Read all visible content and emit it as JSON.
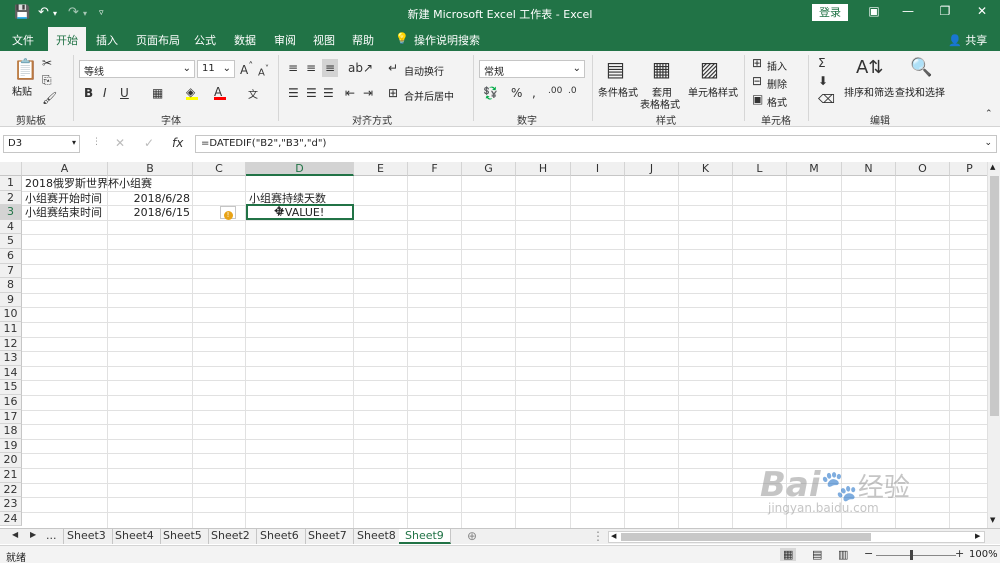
{
  "window": {
    "title": "新建 Microsoft Excel 工作表 - Excel",
    "login_label": "登录",
    "share_label": "共享"
  },
  "ribbon_tabs": [
    "文件",
    "开始",
    "插入",
    "页面布局",
    "公式",
    "数据",
    "审阅",
    "视图",
    "帮助",
    "操作说明搜索"
  ],
  "ribbon": {
    "clipboard": {
      "paste": "粘贴",
      "label": "剪贴板"
    },
    "font": {
      "name": "等线",
      "size": "11",
      "label": "字体"
    },
    "alignment": {
      "wrap": "自动换行",
      "merge": "合并后居中",
      "label": "对齐方式"
    },
    "number": {
      "format": "常规",
      "label": "数字"
    },
    "styles": {
      "conditional": "条件格式",
      "table_1": "套用",
      "table_2": "表格格式",
      "cell_styles": "单元格样式",
      "label": "样式"
    },
    "cells": {
      "insert": "插入",
      "delete": "删除",
      "format": "格式",
      "label": "单元格"
    },
    "editing": {
      "sort": "排序和筛选",
      "find": "查找和选择",
      "label": "编辑"
    }
  },
  "formula_bar": {
    "name_box": "D3",
    "formula": "=DATEDIF(\"B2\",\"B3\",\"d\")",
    "fx": "fx"
  },
  "columns": [
    "A",
    "B",
    "C",
    "D",
    "E",
    "F",
    "G",
    "H",
    "I",
    "J",
    "K",
    "L",
    "M",
    "N",
    "O",
    "P"
  ],
  "rows": [
    "1",
    "2",
    "3",
    "4",
    "5",
    "6",
    "7",
    "8",
    "9",
    "10",
    "11",
    "12",
    "13",
    "14",
    "15",
    "16",
    "17",
    "18",
    "19",
    "20",
    "21",
    "22",
    "23",
    "24"
  ],
  "cells": {
    "A1": "2018俄罗斯世界杯小组赛",
    "A2": "小组赛开始时间",
    "B2": "2018/6/28",
    "D2": "小组赛持续天数",
    "A3": "小组赛结束时间",
    "B3": "2018/6/15",
    "D3": "#VALUE!"
  },
  "sheets": [
    "...",
    "Sheet3",
    "Sheet4",
    "Sheet5",
    "Sheet2",
    "Sheet6",
    "Sheet7",
    "Sheet8",
    "Sheet9"
  ],
  "active_sheet": "Sheet9",
  "status": {
    "text": "就绪",
    "zoom": "100%"
  },
  "watermark": {
    "brand": "Bai",
    "brand_cn": "经验",
    "url": "jingyan.baidu.com"
  },
  "colors": {
    "accent": "#217346"
  }
}
